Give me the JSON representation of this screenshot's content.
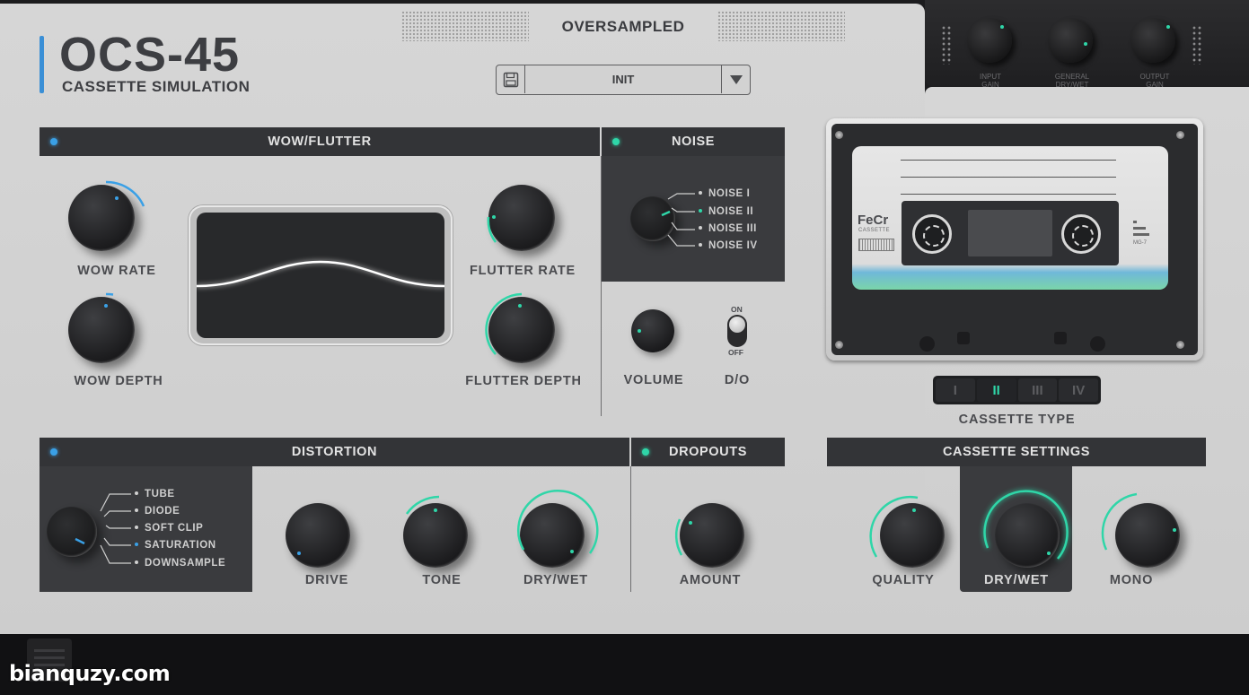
{
  "logo": {
    "title": "OCS-45",
    "subtitle": "CASSETTE SIMULATION"
  },
  "header": {
    "oversampled": "OVERSAMPLED"
  },
  "preset": {
    "name": "INIT",
    "save_icon": "floppy-disk-icon",
    "dropdown_icon": "triangle-down-icon"
  },
  "gain": {
    "input": {
      "label_line1": "INPUT",
      "label_line2": "GAIN"
    },
    "drywet": {
      "label_line1": "GENERAL",
      "label_line2": "DRY/WET"
    },
    "output": {
      "label_line1": "OUTPUT",
      "label_line2": "GAIN"
    }
  },
  "sections": {
    "wow_flutter": "WOW/FLUTTER",
    "noise": "NOISE",
    "distortion": "DISTORTION",
    "dropouts": "DROPOUTS",
    "cassette_settings": "CASSETTE SETTINGS"
  },
  "knobs": {
    "wow_rate": "WOW RATE",
    "wow_depth": "WOW DEPTH",
    "flutter_rate": "FLUTTER RATE",
    "flutter_depth": "FLUTTER DEPTH",
    "volume": "VOLUME",
    "drive": "DRIVE",
    "tone": "TONE",
    "dist_drywet": "DRY/WET",
    "amount": "AMOUNT",
    "quality": "QUALITY",
    "cass_drywet": "DRY/WET",
    "mono": "MONO"
  },
  "noise_options": [
    "NOISE I",
    "NOISE II",
    "NOISE III",
    "NOISE IV"
  ],
  "noise_selected": 1,
  "dist_options": [
    "TUBE",
    "DIODE",
    "SOFT CLIP",
    "SATURATION",
    "DOWNSAMPLE"
  ],
  "dist_selected": 3,
  "dropout_toggle": {
    "label": "D/O",
    "on": "ON",
    "off": "OFF",
    "state": "on"
  },
  "cassette": {
    "brand": "FeCr",
    "brand_sub": "CASSETTE",
    "model": "MG-7",
    "type_label": "CASSETTE TYPE",
    "types": [
      "I",
      "II",
      "III",
      "IV"
    ],
    "type_selected": 1
  },
  "colors": {
    "accent_teal": "#2fd6a8",
    "accent_blue": "#3aa0e6",
    "panel_dark": "#333437"
  },
  "watermark": "bianquzy.com"
}
